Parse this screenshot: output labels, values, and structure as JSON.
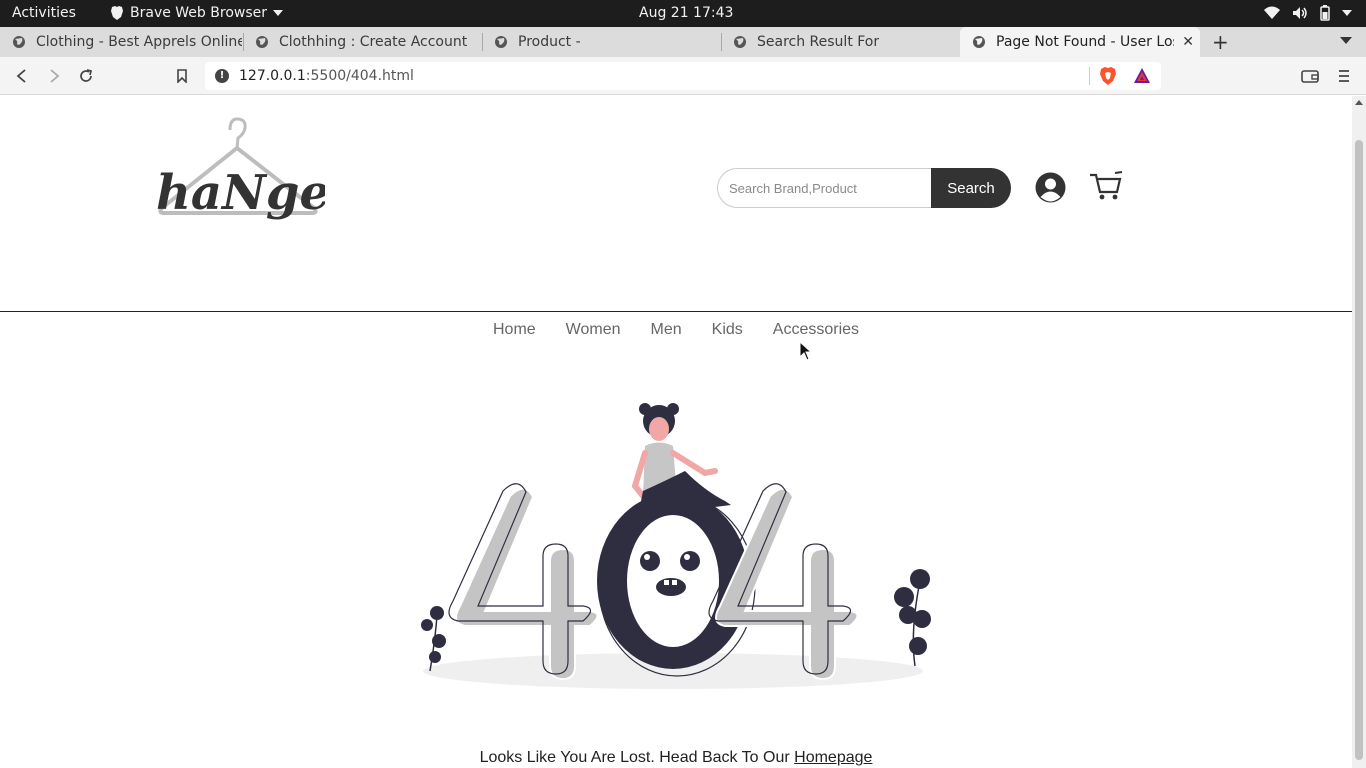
{
  "os": {
    "activities": "Activities",
    "app_name": "Brave Web Browser",
    "clock": "Aug 21  17:43"
  },
  "tabs": [
    {
      "title": "Clothing - Best Apprels Online"
    },
    {
      "title": "Clothhing : Create Account"
    },
    {
      "title": "Product -"
    },
    {
      "title": "Search Result For"
    },
    {
      "title": "Page Not Found - User Lost",
      "active": true
    }
  ],
  "toolbar": {
    "url_host": "127.0.0.1",
    "url_path": ":5500/404.html"
  },
  "site": {
    "logo_text": "haNger",
    "search_placeholder": "Search Brand,Product",
    "search_button": "Search",
    "nav": [
      "Home",
      "Women",
      "Men",
      "Kids",
      "Accessories"
    ],
    "lost_message": "Looks Like You Are Lost. Head Back To Our ",
    "homepage_link": "Homepage"
  },
  "colors": {
    "brave_orange": "#fb542b",
    "dark": "#2f2e41",
    "accent_pink": "#f2a7a7"
  }
}
